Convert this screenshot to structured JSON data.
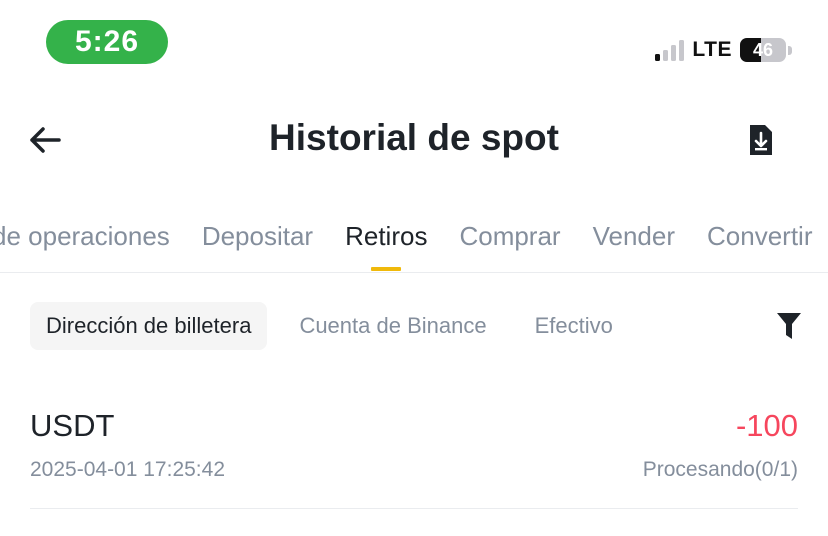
{
  "status_bar": {
    "time": "5:26",
    "network": "LTE",
    "battery": "46",
    "battery_level_percent": 46,
    "signal_bars_active": 1,
    "signal_bars_total": 4,
    "time_pill_color": "#34b24a"
  },
  "header": {
    "title": "Historial de spot",
    "back_icon": "arrow-left-icon",
    "download_icon": "download-document-icon"
  },
  "tabs": [
    {
      "label": "de operaciones",
      "active": false
    },
    {
      "label": "Depositar",
      "active": false
    },
    {
      "label": "Retiros",
      "active": true
    },
    {
      "label": "Comprar",
      "active": false
    },
    {
      "label": "Vender",
      "active": false
    },
    {
      "label": "Convertir",
      "active": false
    }
  ],
  "subfilters": {
    "items": [
      {
        "label": "Dirección de billetera",
        "active": true
      },
      {
        "label": "Cuenta de Binance",
        "active": false
      },
      {
        "label": "Efectivo",
        "active": false
      }
    ],
    "filter_icon": "funnel-icon"
  },
  "records": [
    {
      "asset": "USDT",
      "amount": "-100",
      "datetime": "2025-04-01 17:25:42",
      "status": "Procesando(0/1)"
    }
  ],
  "colors": {
    "accent": "#f0b90b",
    "negative": "#f6465d",
    "text_primary": "#1e2329",
    "text_secondary": "#848e9c"
  }
}
